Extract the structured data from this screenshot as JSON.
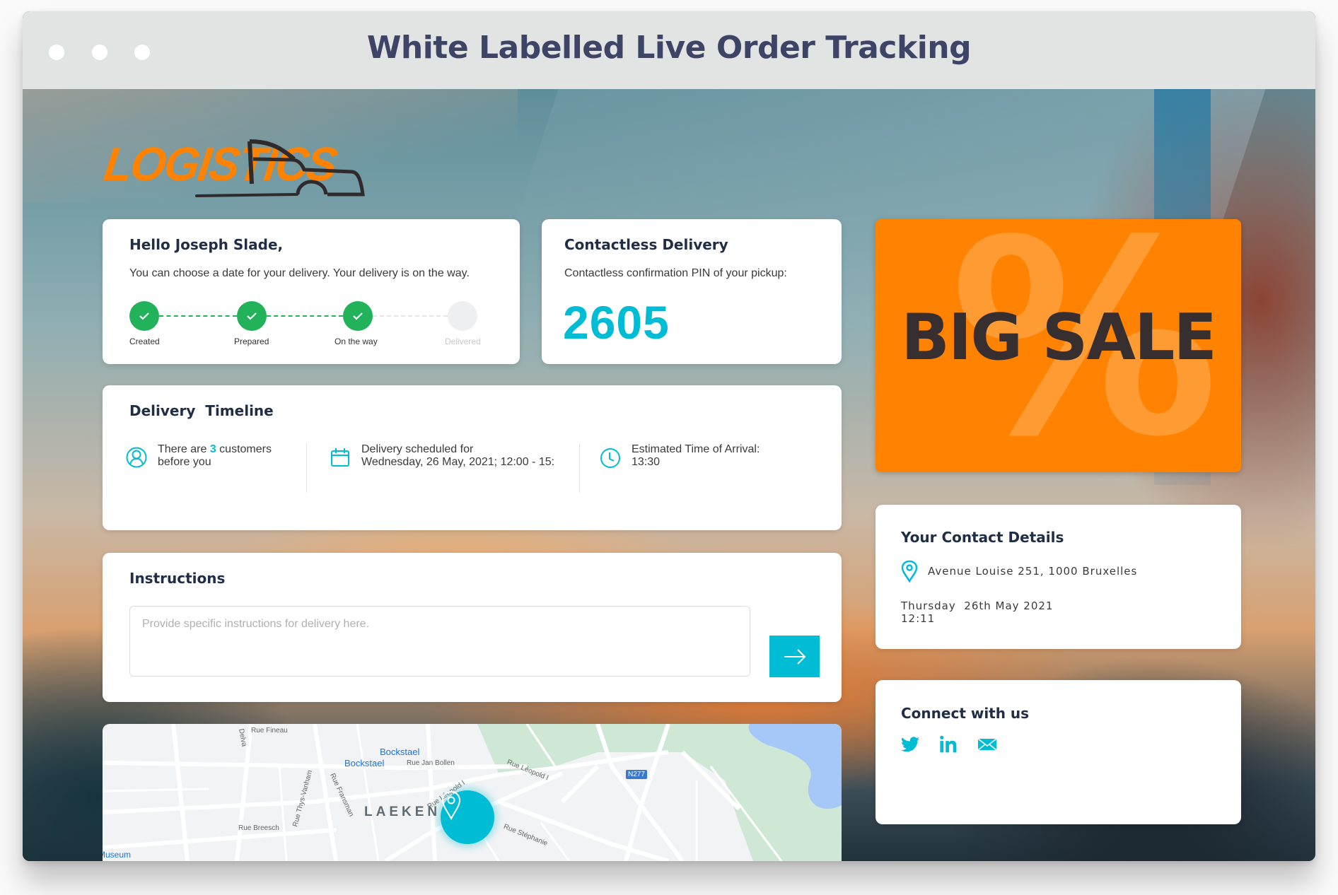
{
  "window": {
    "title": "White Labelled Live Order Tracking"
  },
  "brand": {
    "logo_text": "LOGISTICS",
    "accent_color": "#00bcd4",
    "brand_color": "#ff8200",
    "success_color": "#21b25a"
  },
  "greeting": {
    "title": "Hello Joseph Slade,",
    "description": "You can choose a date for your delivery. Your delivery is on the way.",
    "steps": [
      {
        "label": "Created",
        "status": "done"
      },
      {
        "label": "Prepared",
        "status": "done"
      },
      {
        "label": "On the way",
        "status": "done"
      },
      {
        "label": "Delivered",
        "status": "pending"
      }
    ]
  },
  "contactless": {
    "title": "Contactless Delivery",
    "description": "Contactless confirmation PIN of your pickup:",
    "pin": "2605"
  },
  "promo": {
    "text": "BIG SALE",
    "symbol": "%"
  },
  "timeline": {
    "title": "Delivery  Timeline",
    "queue_prefix": "There are ",
    "queue_count": "3",
    "queue_suffix": " customers",
    "queue_line2": "before you",
    "schedule_line1": "Delivery scheduled for",
    "schedule_line2": "Wednesday, 26 May, 2021; 12:00 - 15:",
    "eta_line1": "Estimated Time of Arrival:",
    "eta_line2": "13:30"
  },
  "instructions": {
    "title": "Instructions",
    "value": "",
    "placeholder": "Provide specific instructions for delivery here.",
    "submit_icon": "arrow-right-icon"
  },
  "map": {
    "area_label": "LAEKEN",
    "labels": [
      "Rue Fineau",
      "Bockstael",
      "Bockstael",
      "Rue Jan Bollen",
      "Rue Léopold I",
      "Rue Léopold I",
      "Rue Fransman",
      "Rue Thys-Vanham",
      "Rue Breesch",
      "Rue Stéphanie",
      "Delva",
      "Museum"
    ],
    "road_badge": "N277"
  },
  "contact": {
    "title": "Your Contact Details",
    "address": "Avenue Louise 251, 1000 Bruxelles",
    "datetime": "Thursday  26th May 2021\n12:11"
  },
  "connect": {
    "title": "Connect with us",
    "links": [
      "twitter-icon",
      "linkedin-icon",
      "email-icon"
    ]
  }
}
